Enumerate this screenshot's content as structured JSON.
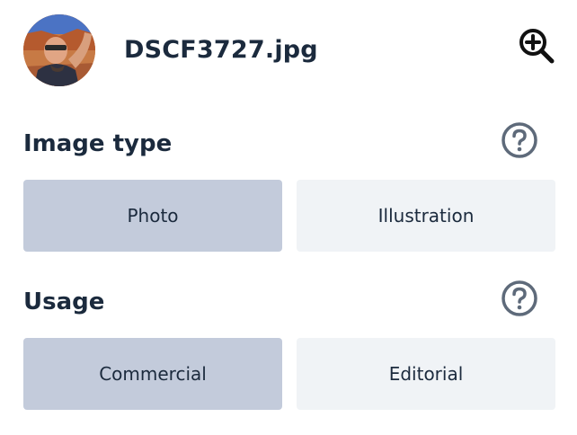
{
  "header": {
    "filename": "DSCF3727.jpg",
    "avatar_icon": "photo-thumbnail",
    "zoom_icon": "zoom-in-icon"
  },
  "image_type": {
    "title": "Image type",
    "help_icon": "question-circle-icon",
    "options": [
      {
        "label": "Photo",
        "selected": true
      },
      {
        "label": "Illustration",
        "selected": false
      }
    ]
  },
  "usage": {
    "title": "Usage",
    "help_icon": "question-circle-icon",
    "options": [
      {
        "label": "Commercial",
        "selected": true
      },
      {
        "label": "Editorial",
        "selected": false
      }
    ]
  },
  "colors": {
    "text": "#1b2a3d",
    "selected_bg": "#c3cbdb",
    "unselected_bg": "#f0f3f6",
    "help_icon": "#5e6a7a"
  }
}
